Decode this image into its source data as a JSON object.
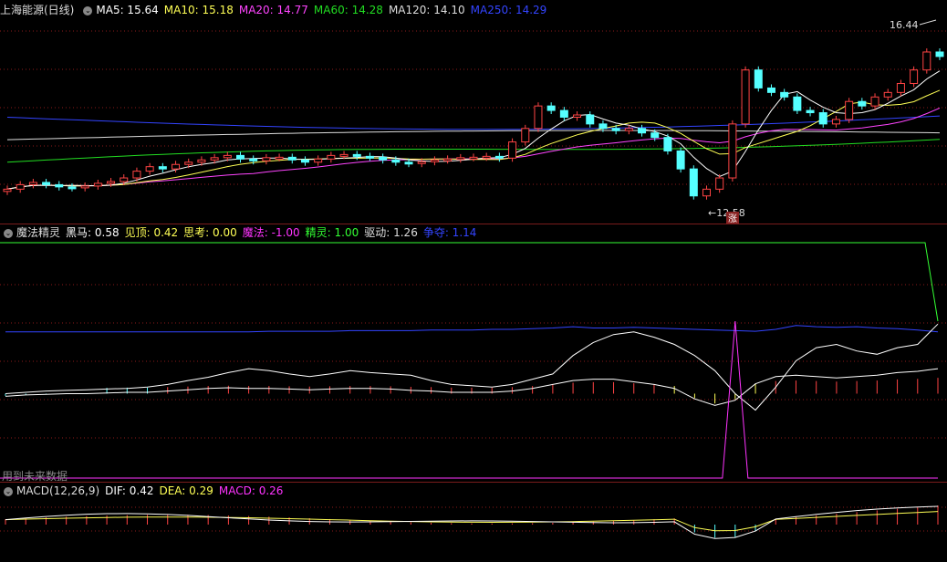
{
  "panels": {
    "main": {
      "title": "上海能源(日线)",
      "legend": [
        {
          "label": "MA5: 15.64",
          "color": "#ffffff"
        },
        {
          "label": "MA10: 15.18",
          "color": "#ffff55"
        },
        {
          "label": "MA20: 14.77",
          "color": "#ff44ff"
        },
        {
          "label": "MA60: 14.28",
          "color": "#22dd22"
        },
        {
          "label": "MA120: 14.10",
          "color": "#dddddd"
        },
        {
          "label": "MA250: 14.29",
          "color": "#3344ff"
        }
      ],
      "high_label": "16.44",
      "low_label": "12.58",
      "mark_label": "涨"
    },
    "indicator": {
      "title": "魔法精灵",
      "legend": [
        {
          "label": "黑马: 0.58",
          "color": "#ffffff"
        },
        {
          "label": "见顶: 0.42",
          "color": "#ffff55"
        },
        {
          "label": "思考: 0.00",
          "color": "#ffff55"
        },
        {
          "label": "魔法: -1.00",
          "color": "#ff33ff"
        },
        {
          "label": "精灵: 1.00",
          "color": "#33ff33"
        },
        {
          "label": "驱动: 1.26",
          "color": "#dddddd"
        },
        {
          "label": "争夺: 1.14",
          "color": "#3344ff"
        }
      ],
      "future_note": "用到未来数据"
    },
    "macd": {
      "title": "MACD(12,26,9)",
      "legend": [
        {
          "label": "DIF: 0.42",
          "color": "#ffffff"
        },
        {
          "label": "DEA: 0.29",
          "color": "#ffff55"
        },
        {
          "label": "MACD: 0.26",
          "color": "#ff33ff"
        }
      ]
    }
  },
  "chart_data": [
    {
      "type": "candlestick",
      "title": "上海能源(日线)",
      "series": [
        {
          "name": "MA5",
          "last": 15.64
        },
        {
          "name": "MA10",
          "last": 15.18
        },
        {
          "name": "MA20",
          "last": 14.77
        },
        {
          "name": "MA60",
          "last": 14.28
        },
        {
          "name": "MA120",
          "last": 14.1
        },
        {
          "name": "MA250",
          "last": 14.29
        }
      ],
      "close": [
        12.95,
        13.05,
        13.1,
        13.05,
        13.0,
        12.98,
        13.02,
        13.08,
        13.12,
        13.2,
        13.35,
        13.45,
        13.4,
        13.5,
        13.55,
        13.6,
        13.65,
        13.7,
        13.62,
        13.58,
        13.65,
        13.66,
        13.6,
        13.55,
        13.62,
        13.7,
        13.72,
        13.68,
        13.66,
        13.6,
        13.55,
        13.52,
        13.56,
        13.6,
        13.62,
        13.65,
        13.66,
        13.68,
        13.64,
        14.0,
        14.3,
        14.8,
        14.7,
        14.55,
        14.6,
        14.4,
        14.3,
        14.25,
        14.3,
        14.2,
        14.1,
        13.8,
        13.4,
        12.8,
        12.95,
        13.2,
        14.4,
        15.6,
        15.2,
        15.1,
        15.0,
        14.7,
        14.65,
        14.4,
        14.5,
        14.9,
        14.8,
        15.0,
        15.1,
        15.3,
        15.6,
        16.0,
        15.9
      ],
      "high_marker": 16.44,
      "low_marker": 12.58
    },
    {
      "type": "line",
      "title": "魔法精灵",
      "series": [
        {
          "name": "黑马",
          "last": 0.58
        },
        {
          "name": "见顶",
          "last": 0.42
        },
        {
          "name": "思考",
          "last": 0.0
        },
        {
          "name": "魔法",
          "last": -1.0
        },
        {
          "name": "精灵",
          "last": 1.0
        },
        {
          "name": "驱动",
          "last": 1.26
        },
        {
          "name": "争夺",
          "last": 1.14
        }
      ],
      "driver": [
        0.2,
        0.22,
        0.24,
        0.25,
        0.26,
        0.27,
        0.28,
        0.3,
        0.34,
        0.4,
        0.45,
        0.52,
        0.58,
        0.55,
        0.5,
        0.46,
        0.5,
        0.55,
        0.52,
        0.5,
        0.48,
        0.4,
        0.34,
        0.32,
        0.3,
        0.34,
        0.42,
        0.5,
        0.78,
        0.98,
        1.1,
        1.14,
        1.06,
        0.95,
        0.78,
        0.55,
        0.2,
        -0.05,
        0.3,
        0.7,
        0.9,
        0.95,
        0.85,
        0.8,
        0.9,
        0.95,
        1.26
      ],
      "dark_horse": [
        0.16,
        0.18,
        0.19,
        0.2,
        0.2,
        0.21,
        0.22,
        0.22,
        0.24,
        0.26,
        0.28,
        0.29,
        0.28,
        0.28,
        0.27,
        0.26,
        0.27,
        0.28,
        0.28,
        0.27,
        0.25,
        0.24,
        0.22,
        0.22,
        0.22,
        0.24,
        0.28,
        0.34,
        0.4,
        0.42,
        0.42,
        0.38,
        0.34,
        0.28,
        0.12,
        0.02,
        0.1,
        0.35,
        0.46,
        0.48,
        0.46,
        0.44,
        0.46,
        0.48,
        0.52,
        0.54,
        0.58
      ],
      "contest": [
        1.14,
        1.14,
        1.14,
        1.14,
        1.14,
        1.14,
        1.14,
        1.14,
        1.14,
        1.14,
        1.14,
        1.14,
        1.14,
        1.15,
        1.15,
        1.15,
        1.15,
        1.16,
        1.16,
        1.16,
        1.16,
        1.17,
        1.17,
        1.17,
        1.18,
        1.18,
        1.19,
        1.2,
        1.22,
        1.2,
        1.2,
        1.21,
        1.2,
        1.19,
        1.18,
        1.17,
        1.16,
        1.15,
        1.18,
        1.24,
        1.22,
        1.21,
        1.22,
        1.2,
        1.19,
        1.17,
        1.14
      ],
      "magic_spike_index": 36,
      "spirit_flat": 1.0,
      "ylim": [
        -1.1,
        2.5
      ]
    },
    {
      "type": "bar",
      "title": "MACD(12,26,9)",
      "series": [
        {
          "name": "DIF",
          "last": 0.42
        },
        {
          "name": "DEA",
          "last": 0.29
        },
        {
          "name": "MACD",
          "last": 0.26
        }
      ]
    }
  ],
  "colors": {
    "up": "#ff4444",
    "down": "#55ffff",
    "grid": "#8b1a1a",
    "divider": "#7a1c1c"
  }
}
